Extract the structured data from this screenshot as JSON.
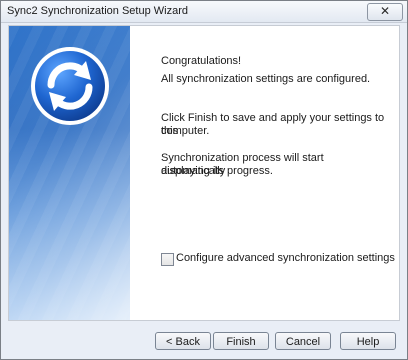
{
  "window": {
    "title": "Sync2 Synchronization Setup Wizard",
    "close_label": "✕"
  },
  "content": {
    "heading": "Congratulations!",
    "line1": "All synchronization settings are configured.",
    "instruction1": "Click Finish to save and apply your settings to this",
    "instruction2": "computer.",
    "process1": "Synchronization process will start automatically",
    "process2": "displaying its progress."
  },
  "options": {
    "advanced_label": "Configure advanced synchronization settings",
    "advanced_checked": false
  },
  "buttons": {
    "back": "< Back",
    "finish": "Finish",
    "cancel": "Cancel",
    "help": "Help"
  },
  "colors": {
    "banner_top": "#2f73c9",
    "banner_bottom": "#9cc2ee",
    "logo_blue": "#1c63c7"
  },
  "icons": {
    "logo": "sync-arrows-icon",
    "close": "close-icon"
  }
}
